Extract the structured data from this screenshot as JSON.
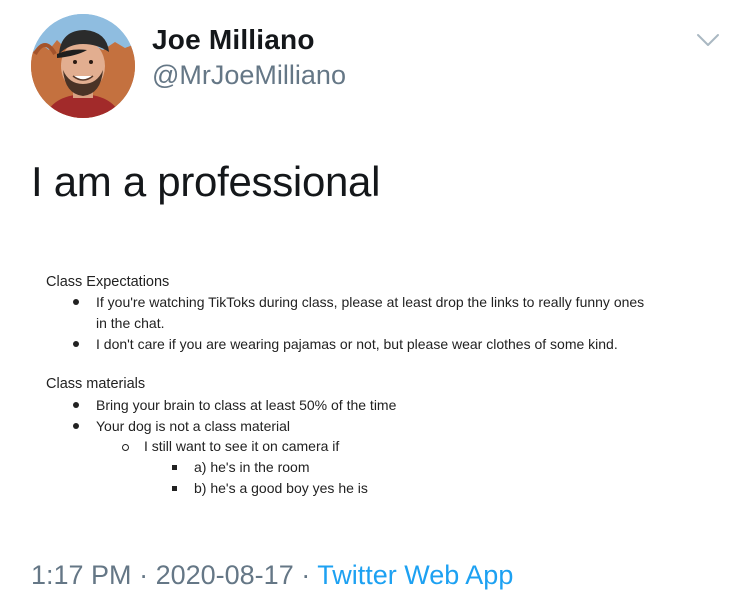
{
  "author": {
    "display_name": "Joe Milliano",
    "handle": "@MrJoeMilliano"
  },
  "icons": {
    "menu": "chevron-down-icon",
    "avatar": "avatar"
  },
  "tweet": {
    "text": "I am a professional"
  },
  "attached_document": {
    "sections": [
      {
        "title": "Class Expectations",
        "items": [
          "If you're watching TikToks during class, please at least drop the links to really funny ones",
          "in the chat.",
          "I don't care if you are wearing pajamas or not, but please wear clothes of some kind."
        ]
      },
      {
        "title": "Class materials",
        "items": [
          "Bring your brain to class at least 50% of the time",
          "Your dog is not a class material",
          "I still want to see it on camera if",
          "a) he's in the room",
          "b) he's a good boy yes he is"
        ]
      }
    ]
  },
  "meta": {
    "time": "1:17 PM",
    "separator": "·",
    "date": "2020-08-17",
    "source": "Twitter Web App"
  },
  "colors": {
    "link": "#1da1f2",
    "secondary_text": "#657786",
    "primary_text": "#14171a"
  }
}
